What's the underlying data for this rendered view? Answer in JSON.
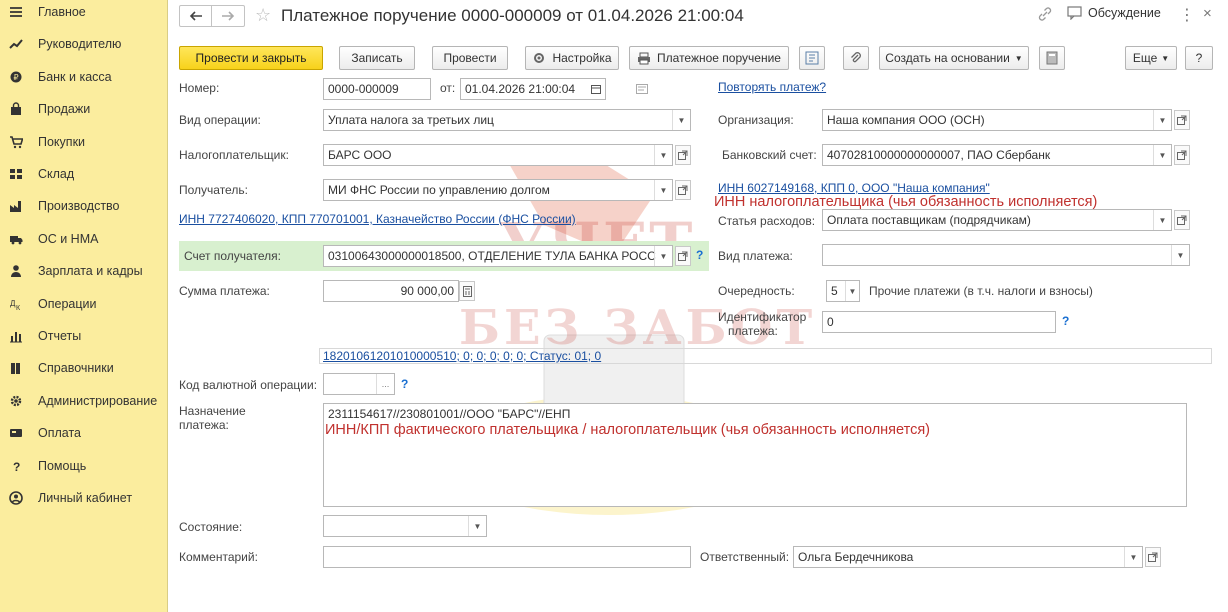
{
  "sidebar": {
    "items": [
      {
        "label": "Главное",
        "icon": "menu-icon"
      },
      {
        "label": "Руководителю",
        "icon": "trend-icon"
      },
      {
        "label": "Банк и касса",
        "icon": "coin-icon"
      },
      {
        "label": "Продажи",
        "icon": "bag-icon"
      },
      {
        "label": "Покупки",
        "icon": "cart-icon"
      },
      {
        "label": "Склад",
        "icon": "warehouse-icon"
      },
      {
        "label": "Производство",
        "icon": "factory-icon"
      },
      {
        "label": "ОС и НМА",
        "icon": "truck-icon"
      },
      {
        "label": "Зарплата и кадры",
        "icon": "person-icon"
      },
      {
        "label": "Операции",
        "icon": "operations-icon"
      },
      {
        "label": "Отчеты",
        "icon": "chart-icon"
      },
      {
        "label": "Справочники",
        "icon": "books-icon"
      },
      {
        "label": "Администрирование",
        "icon": "gear-icon"
      },
      {
        "label": "Оплата",
        "icon": "payment-icon"
      },
      {
        "label": "Помощь",
        "icon": "help-icon"
      },
      {
        "label": "Личный кабинет",
        "icon": "account-icon"
      }
    ]
  },
  "header": {
    "title": "Платежное поручение 0000-000009 от 01.04.2026 21:00:04",
    "discussion": "Обсуждение"
  },
  "toolbar": {
    "post_close": "Провести и закрыть",
    "save": "Записать",
    "post": "Провести",
    "settings": "Настройка",
    "print": "Платежное поручение",
    "create_based": "Создать на основании",
    "more": "Еще",
    "help": "?"
  },
  "form": {
    "number_label": "Номер:",
    "number_value": "0000-000009",
    "date_label": "от:",
    "date_value": "01.04.2026 21:00:04",
    "repeat_link": "Повторять платеж?",
    "operation_label": "Вид операции:",
    "operation_value": "Уплата налога за третьих лиц",
    "org_label": "Организация:",
    "org_value": "Наша компания ООО (ОСН)",
    "taxpayer_label": "Налогоплательщик:",
    "taxpayer_value": "БАРС ООО",
    "bank_account_label": "Банковский счет:",
    "bank_account_value": "40702810000000000007, ПАО Сбербанк",
    "recipient_label": "Получатель:",
    "recipient_value": "МИ ФНС России по управлению долгом",
    "org_inn_link": "ИНН 6027149168, КПП 0, ООО \"Наша компания\"",
    "note_inn_taxpayer": "ИНН налогоплательщика (чья обязанность исполняется)",
    "recipient_inn_link": "ИНН 7727406020, КПП 770701001, Казначейство России (ФНС России)",
    "expense_label": "Статья расходов:",
    "expense_value": "Оплата поставщикам (подрядчикам)",
    "recipient_account_label": "Счет получателя:",
    "recipient_account_value": "03100643000000018500, ОТДЕЛЕНИЕ ТУЛА БАНКА РОСС",
    "payment_type_label": "Вид платежа:",
    "payment_type_value": "",
    "amount_label": "Сумма платежа:",
    "amount_value": "90 000,00",
    "priority_label": "Очередность:",
    "priority_value": "5",
    "priority_text": "Прочие платежи (в т.ч. налоги и взносы)",
    "identifier_label_1": "Идентификатор",
    "identifier_label_2": "платежа:",
    "identifier_value": "0",
    "kbk_link": "18201061201010000510; 0; 0; 0; 0; 0; Статус: 01; 0",
    "currency_op_label": "Код валютной операции:",
    "currency_op_value": "",
    "purpose_label_1": "Назначение",
    "purpose_label_2": "платежа:",
    "purpose_value": "2311154617//230801001//ООО \"БАРС\"//ЕНП",
    "note_purpose": "ИНН/КПП фактического плательщика / налогоплательщик (чья обязанность исполняется)",
    "state_label": "Состояние:",
    "state_value": "",
    "comment_label": "Комментарий:",
    "comment_value": "",
    "responsible_label": "Ответственный:",
    "responsible_value": "Ольга Бердечникова"
  },
  "watermark": "УЧЕТ БЕЗ ЗАБОТ",
  "colors": {
    "sidebar_bg": "#fbed9e",
    "primary_button": "#f7d21b",
    "link": "#1a4fa0",
    "note_red": "#c0312e",
    "highlight_row": "#d8f0cf"
  }
}
